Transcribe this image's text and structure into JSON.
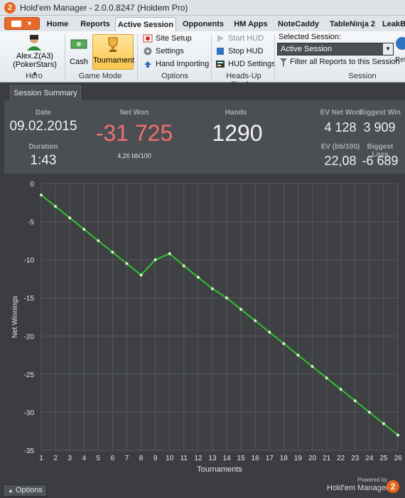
{
  "window": {
    "title": "Hold'em Manager - 2.0.0.8247 (Holdem Pro)",
    "logo": "2"
  },
  "menu": {
    "tabs": [
      {
        "label": "Home"
      },
      {
        "label": "Reports"
      },
      {
        "label": "Active Session",
        "active": true
      },
      {
        "label": "Opponents"
      },
      {
        "label": "HM Apps"
      },
      {
        "label": "NoteCaddy"
      },
      {
        "label": "TableNinja 2"
      },
      {
        "label": "LeakB"
      }
    ]
  },
  "ribbon": {
    "hero": {
      "name": "Alex.Z(A3)",
      "site": "(PokerStars)",
      "group": "Hero"
    },
    "game_mode": {
      "cash": "Cash",
      "tournament": "Tournament",
      "group": "Game Mode",
      "selected": "Tournament"
    },
    "options": {
      "site_setup": "Site Setup",
      "settings": "Settings",
      "hand_importing": "Hand Importing",
      "group": "Options"
    },
    "hud": {
      "start": "Start HUD",
      "stop": "Stop HUD",
      "settings": "HUD Settings",
      "group": "Heads-Up Display"
    },
    "session": {
      "title": "Selected Session:",
      "value": "Active Session",
      "filter": "Filter all Reports to this Session",
      "group": "Session"
    },
    "refresh_label": "Ref"
  },
  "summary_tab": "Session Summary",
  "stats": {
    "date_label": "Date",
    "date": "09.02.2015",
    "duration_label": "Duration",
    "duration": "1:43",
    "net_won_label": "Net Won",
    "net_won": "-31 725",
    "bb_per_100": "4,26 bb/100",
    "hands_label": "Hands",
    "hands": "1290",
    "ev_net_won_label": "EV Net Won",
    "ev_net_won": "4 128",
    "biggest_win_label": "Biggest Win",
    "biggest_win": "3 909",
    "ev_bb_label": "EV (bb/100)",
    "ev_bb": "22,08",
    "biggest_loss_label": "Biggest Loss",
    "biggest_loss": "-6 689",
    "net_won_color": "#f07070"
  },
  "chart_data": {
    "type": "line",
    "xlabel": "Tournaments",
    "ylabel": "Net Winnings",
    "xlim": [
      1,
      26
    ],
    "ylim": [
      -35,
      0
    ],
    "x_ticks": [
      1,
      2,
      3,
      4,
      5,
      6,
      7,
      8,
      9,
      10,
      11,
      12,
      13,
      14,
      15,
      16,
      17,
      18,
      19,
      20,
      21,
      22,
      23,
      24,
      25,
      26
    ],
    "y_ticks": [
      0,
      -5,
      -10,
      -15,
      -20,
      -25,
      -30,
      -35
    ],
    "grid": true,
    "series": [
      {
        "color": "#2fc32f",
        "x": [
          1,
          2,
          3,
          4,
          5,
          6,
          7,
          8,
          9,
          10,
          11,
          12,
          13,
          14,
          15,
          16,
          17,
          18,
          19,
          20,
          21,
          22,
          23,
          24,
          25,
          26
        ],
        "y": [
          -1.5,
          -3.0,
          -4.5,
          -6.0,
          -7.5,
          -9.0,
          -10.5,
          -12.0,
          -10.0,
          -9.2,
          -10.8,
          -12.3,
          -13.8,
          -15.0,
          -16.5,
          -18.0,
          -19.5,
          -21.0,
          -22.5,
          -24.0,
          -25.5,
          -27.0,
          -28.5,
          -30.0,
          -31.5,
          -33.0
        ]
      }
    ]
  },
  "footer": {
    "options": "Options",
    "powered": "Powered by",
    "brand": "Hold'em Manager",
    "brand_logo": "2"
  }
}
